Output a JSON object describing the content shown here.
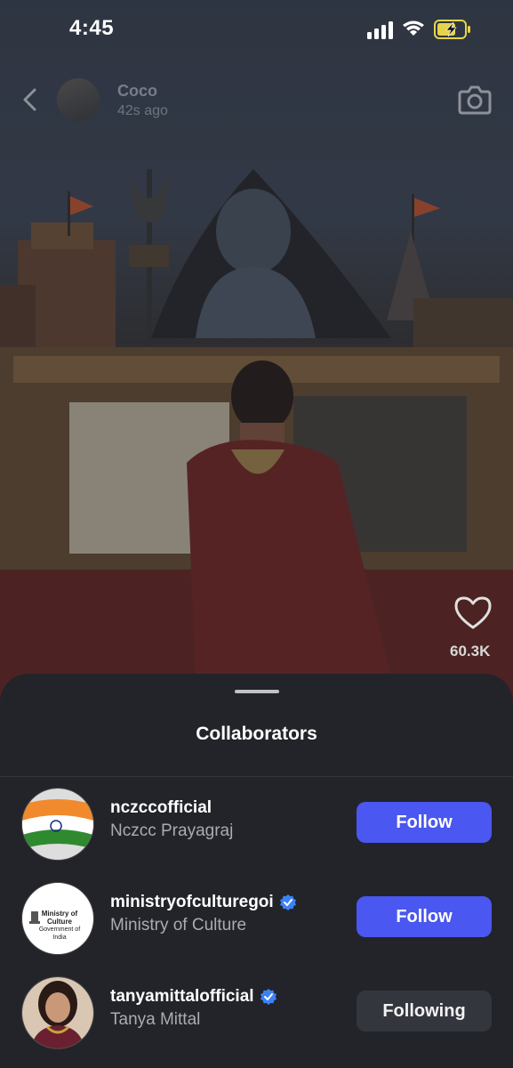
{
  "status_bar": {
    "time": "4:45"
  },
  "post_header": {
    "username": "Coco",
    "time_ago": "42s ago"
  },
  "likes": {
    "count": "60.3K"
  },
  "sheet": {
    "title": "Collaborators",
    "collaborators": [
      {
        "handle": "nczccofficial",
        "name": "Nczcc Prayagraj",
        "verified": false,
        "button": "Follow"
      },
      {
        "handle": "ministryofculturegoi",
        "name": "Ministry of Culture",
        "verified": true,
        "button": "Follow",
        "logo_text_1": "Ministry of Culture",
        "logo_text_2": "Government of India"
      },
      {
        "handle": "tanyamittalofficial",
        "name": "Tanya Mittal",
        "verified": true,
        "button": "Following"
      }
    ]
  },
  "colors": {
    "follow_button": "#4a57f0",
    "following_button": "#34363d",
    "verified": "#3b82f6",
    "sheet_bg": "#232429"
  }
}
